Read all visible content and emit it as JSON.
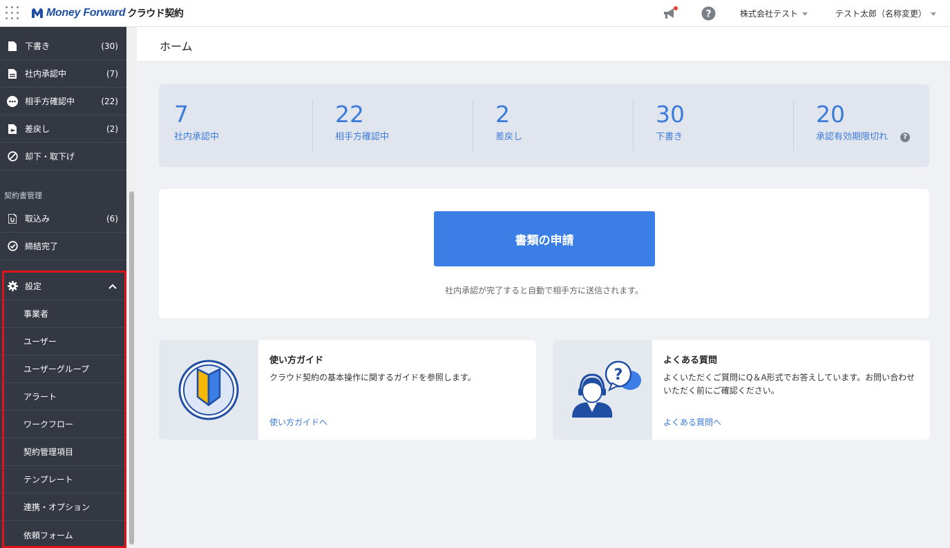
{
  "header": {
    "brand": "Money Forward",
    "product": "クラウド契約",
    "company_selector": "株式会社テスト",
    "user_selector": "テスト太郎（名称変更）",
    "colors": {
      "brand": "#1f4ea3",
      "notification_dot": "#e8412f"
    }
  },
  "sidebar": {
    "top_items": [
      {
        "label": "下書き",
        "count": "(30)",
        "icon": "document-icon"
      },
      {
        "label": "社内承認中",
        "count": "(7)",
        "icon": "document-lines-icon"
      },
      {
        "label": "相手方確認中",
        "count": "(22)",
        "icon": "ellipsis-circle-icon"
      },
      {
        "label": "差戻し",
        "count": "(2)",
        "icon": "document-return-icon"
      },
      {
        "label": "却下・取下げ",
        "count": "",
        "icon": "prohibited-icon"
      }
    ],
    "section_label": "契約書管理",
    "manage_items": [
      {
        "label": "取込み",
        "count": "(6)",
        "icon": "document-import-icon"
      },
      {
        "label": "締結完了",
        "count": "",
        "icon": "check-circle-icon"
      }
    ],
    "settings": {
      "label": "設定",
      "icon": "gear-icon",
      "sub_items": [
        "事業者",
        "ユーザー",
        "ユーザーグループ",
        "アラート",
        "ワークフロー",
        "契約管理項目",
        "テンプレート",
        "連携・オプション",
        "依頼フォーム"
      ]
    }
  },
  "main": {
    "page_title": "ホーム",
    "stats": [
      {
        "value": "7",
        "label": "社内承認中"
      },
      {
        "value": "22",
        "label": "相手方確認中"
      },
      {
        "value": "2",
        "label": "差戻し"
      },
      {
        "value": "30",
        "label": "下書き"
      },
      {
        "value": "20",
        "label": "承認有効期限切れ"
      }
    ],
    "help_mark": "?",
    "apply_button": "書類の申請",
    "apply_note": "社内承認が完了すると自動で相手方に送信されます。",
    "cards": [
      {
        "title": "使い方ガイド",
        "desc": "クラウド契約の基本操作に関するガイドを参照します。",
        "link": "使い方ガイドへ",
        "icon": "beginner-mark-icon"
      },
      {
        "title": "よくある質問",
        "desc": "よくいただくご質問にQ＆A形式でお答えしています。お問い合わせいただく前にご確認ください。",
        "link": "よくある質問へ",
        "icon": "support-operator-icon"
      }
    ],
    "colors": {
      "accent": "#3b7fe6",
      "stat_text": "#3b7bd9",
      "highlight_border": "#e0131b"
    }
  }
}
